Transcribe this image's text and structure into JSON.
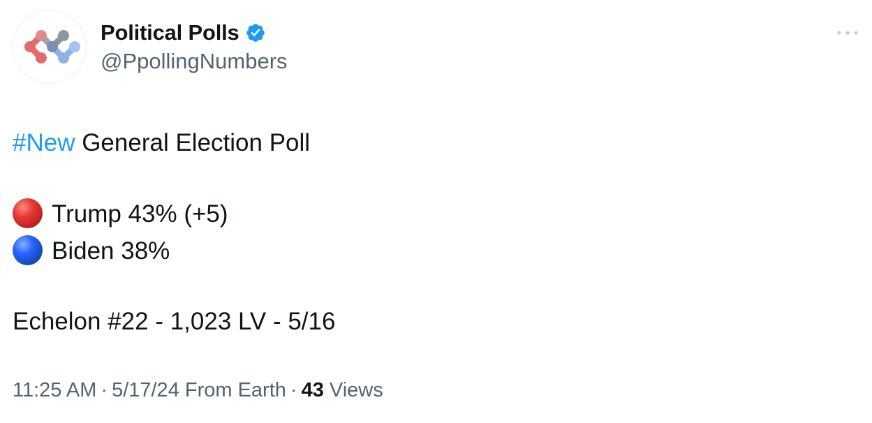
{
  "author": {
    "display_name": "Political Polls",
    "handle": "@PpollingNumbers",
    "avatar_icon": "polling-network-logo-icon",
    "verified": true,
    "verified_icon": "verified-badge-icon",
    "verified_color": "#1d9bf0"
  },
  "menu_icon": "more-options-icon",
  "post": {
    "hashtag": "#New",
    "line1_rest": " General Election Poll",
    "candidates": [
      {
        "emoji": "red-circle",
        "color": "#d32f2f",
        "text": "Trump 43% (+5)"
      },
      {
        "emoji": "blue-circle",
        "color": "#1565c0",
        "text": "Biden 38%"
      }
    ],
    "source_line": "Echelon #22 - 1,023 LV - 5/16"
  },
  "meta": {
    "time": "11:25 AM",
    "date": "5/17/24 From Earth",
    "separator": "·",
    "views_count": "43",
    "views_label": "Views"
  },
  "colors": {
    "text": "#0f1419",
    "secondary": "#536471",
    "link": "#1d9bf0"
  }
}
